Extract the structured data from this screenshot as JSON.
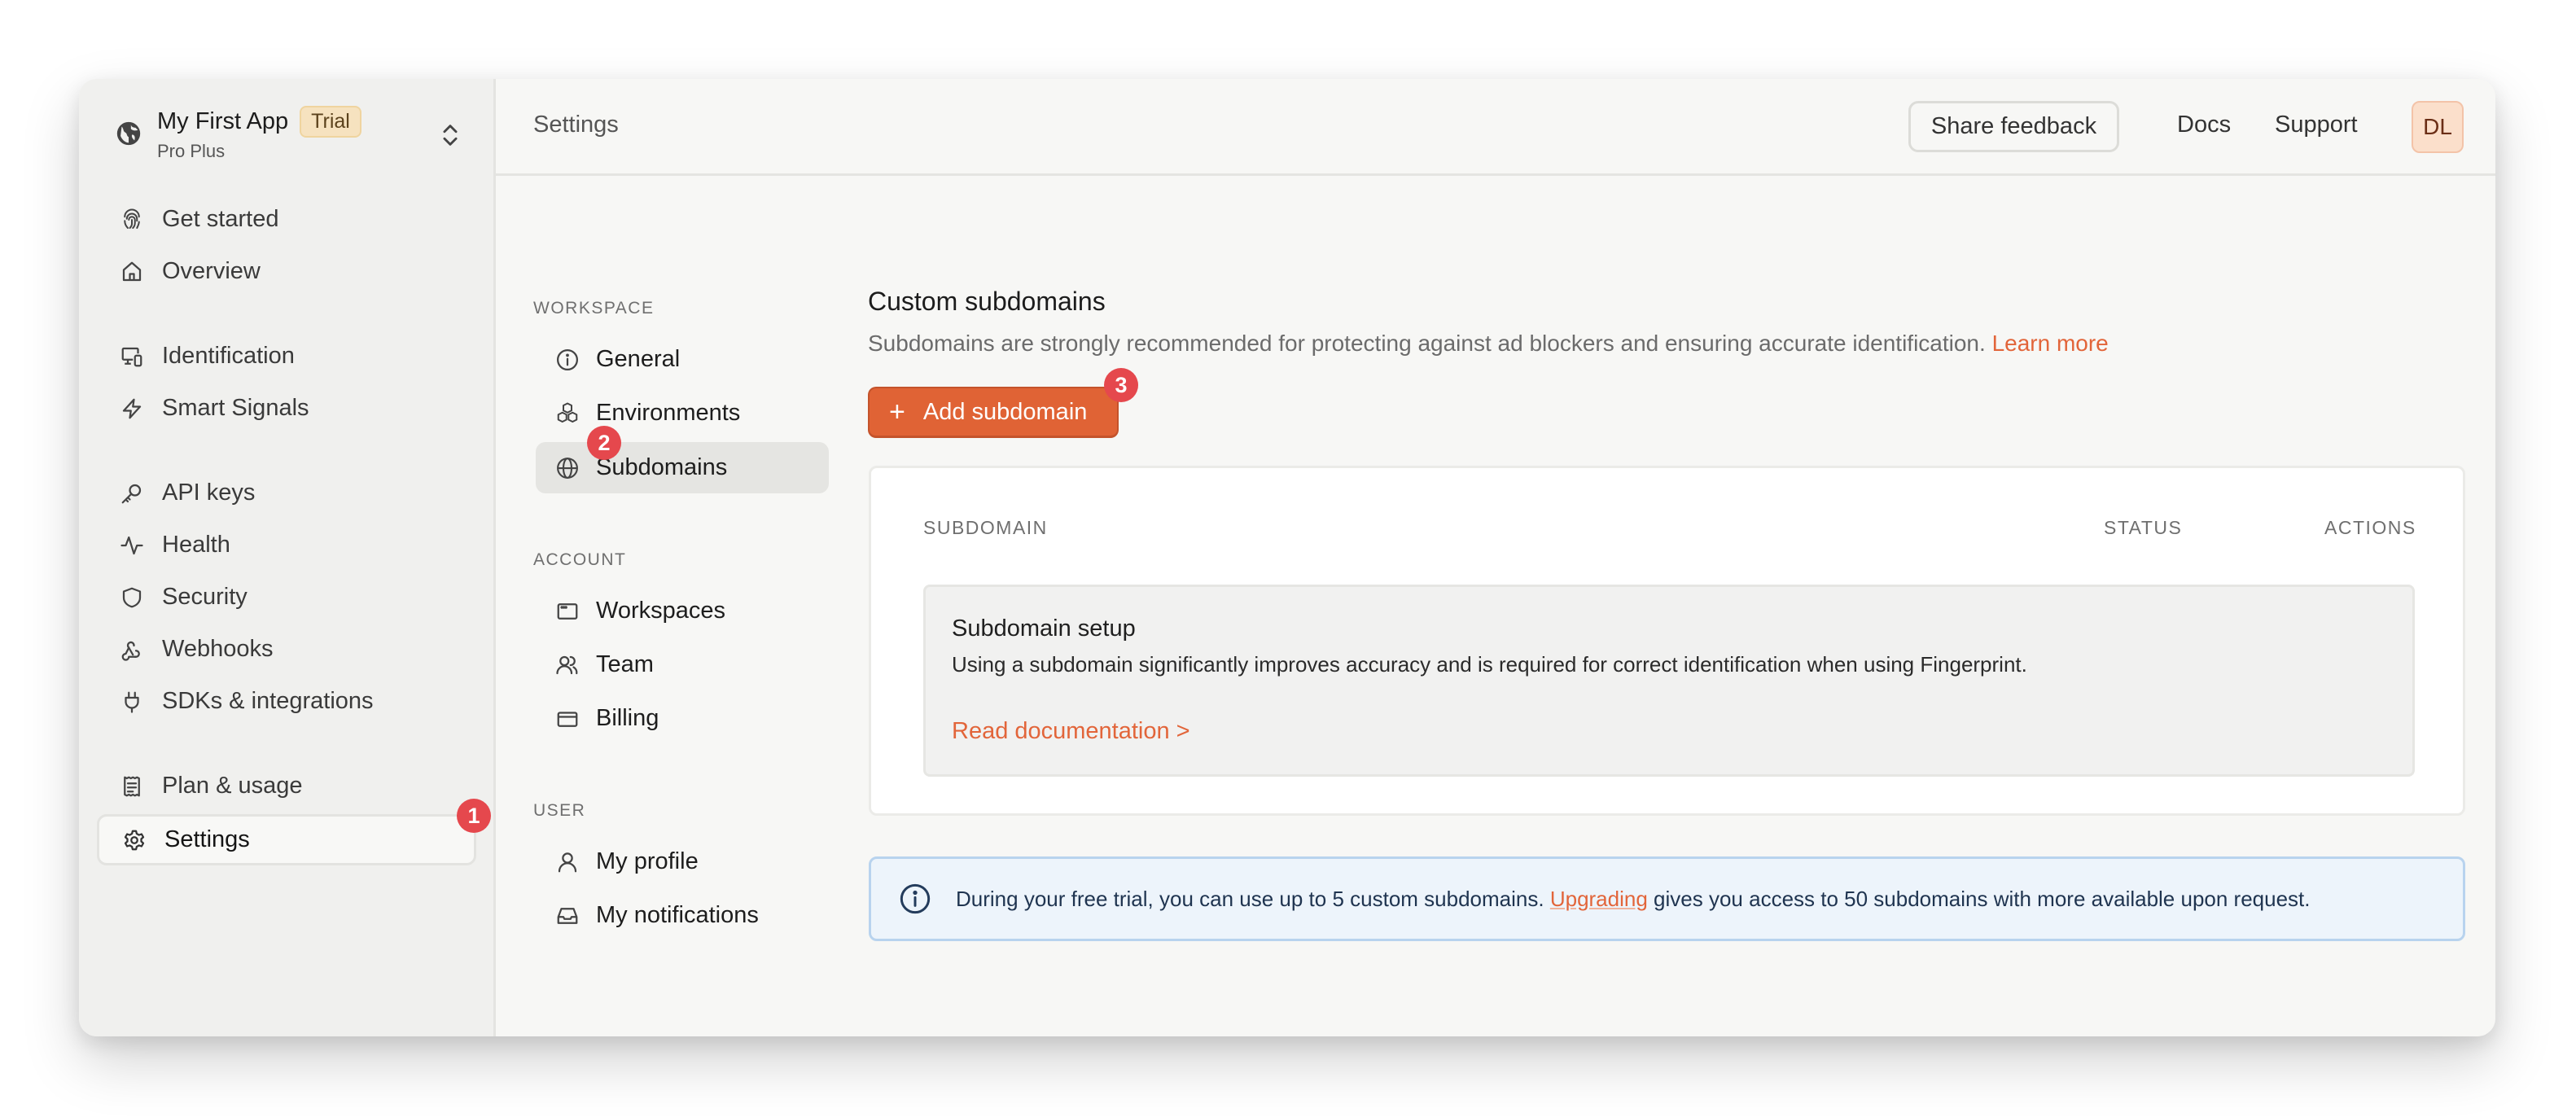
{
  "app": {
    "name": "My First App",
    "badge": "Trial",
    "plan": "Pro Plus"
  },
  "sidebar": {
    "items": [
      {
        "label": "Get started",
        "icon": "fingerprint-icon"
      },
      {
        "label": "Overview",
        "icon": "home-icon"
      },
      {
        "label": "Identification",
        "icon": "devices-icon"
      },
      {
        "label": "Smart Signals",
        "icon": "lightning-icon"
      },
      {
        "label": "API keys",
        "icon": "key-icon"
      },
      {
        "label": "Health",
        "icon": "activity-icon"
      },
      {
        "label": "Security",
        "icon": "shield-icon"
      },
      {
        "label": "Webhooks",
        "icon": "webhook-icon"
      },
      {
        "label": "SDKs & integrations",
        "icon": "plug-icon"
      },
      {
        "label": "Plan & usage",
        "icon": "receipt-icon"
      },
      {
        "label": "Settings",
        "icon": "gear-icon",
        "active": true
      }
    ]
  },
  "header": {
    "title": "Settings",
    "share_feedback": "Share feedback",
    "docs": "Docs",
    "support": "Support",
    "avatar_initials": "DL"
  },
  "settings_nav": {
    "sections": [
      {
        "title": "WORKSPACE",
        "items": [
          {
            "label": "General",
            "icon": "info-icon"
          },
          {
            "label": "Environments",
            "icon": "cubes-icon"
          },
          {
            "label": "Subdomains",
            "icon": "globe-icon",
            "active": true
          }
        ]
      },
      {
        "title": "ACCOUNT",
        "items": [
          {
            "label": "Workspaces",
            "icon": "browser-window-icon"
          },
          {
            "label": "Team",
            "icon": "users-icon"
          },
          {
            "label": "Billing",
            "icon": "credit-card-icon"
          }
        ]
      },
      {
        "title": "USER",
        "items": [
          {
            "label": "My profile",
            "icon": "user-icon"
          },
          {
            "label": "My notifications",
            "icon": "inbox-icon"
          }
        ]
      }
    ]
  },
  "main": {
    "title": "Custom subdomains",
    "description": "Subdomains are strongly recommended for protecting against ad blockers and ensuring accurate identification.",
    "learn_more": "Learn more",
    "add_button": "Add subdomain",
    "table": {
      "columns": [
        "SUBDOMAIN",
        "STATUS",
        "ACTIONS"
      ],
      "empty_state": {
        "title": "Subdomain setup",
        "description": "Using a subdomain significantly improves accuracy and is required for correct identification when using Fingerprint.",
        "link": "Read documentation >"
      }
    },
    "info_banner": {
      "text_before": "During your free trial, you can use up to 5 custom subdomains.",
      "link": "Upgrading",
      "text_after": "gives you access to 50 subdomains with more available upon request."
    }
  },
  "step_badges": [
    "1",
    "2",
    "3"
  ],
  "colors": {
    "accent": "#e06335",
    "badge": "#e5484d",
    "info_bg": "#edf4fb",
    "info_border": "#b8d3ee"
  }
}
